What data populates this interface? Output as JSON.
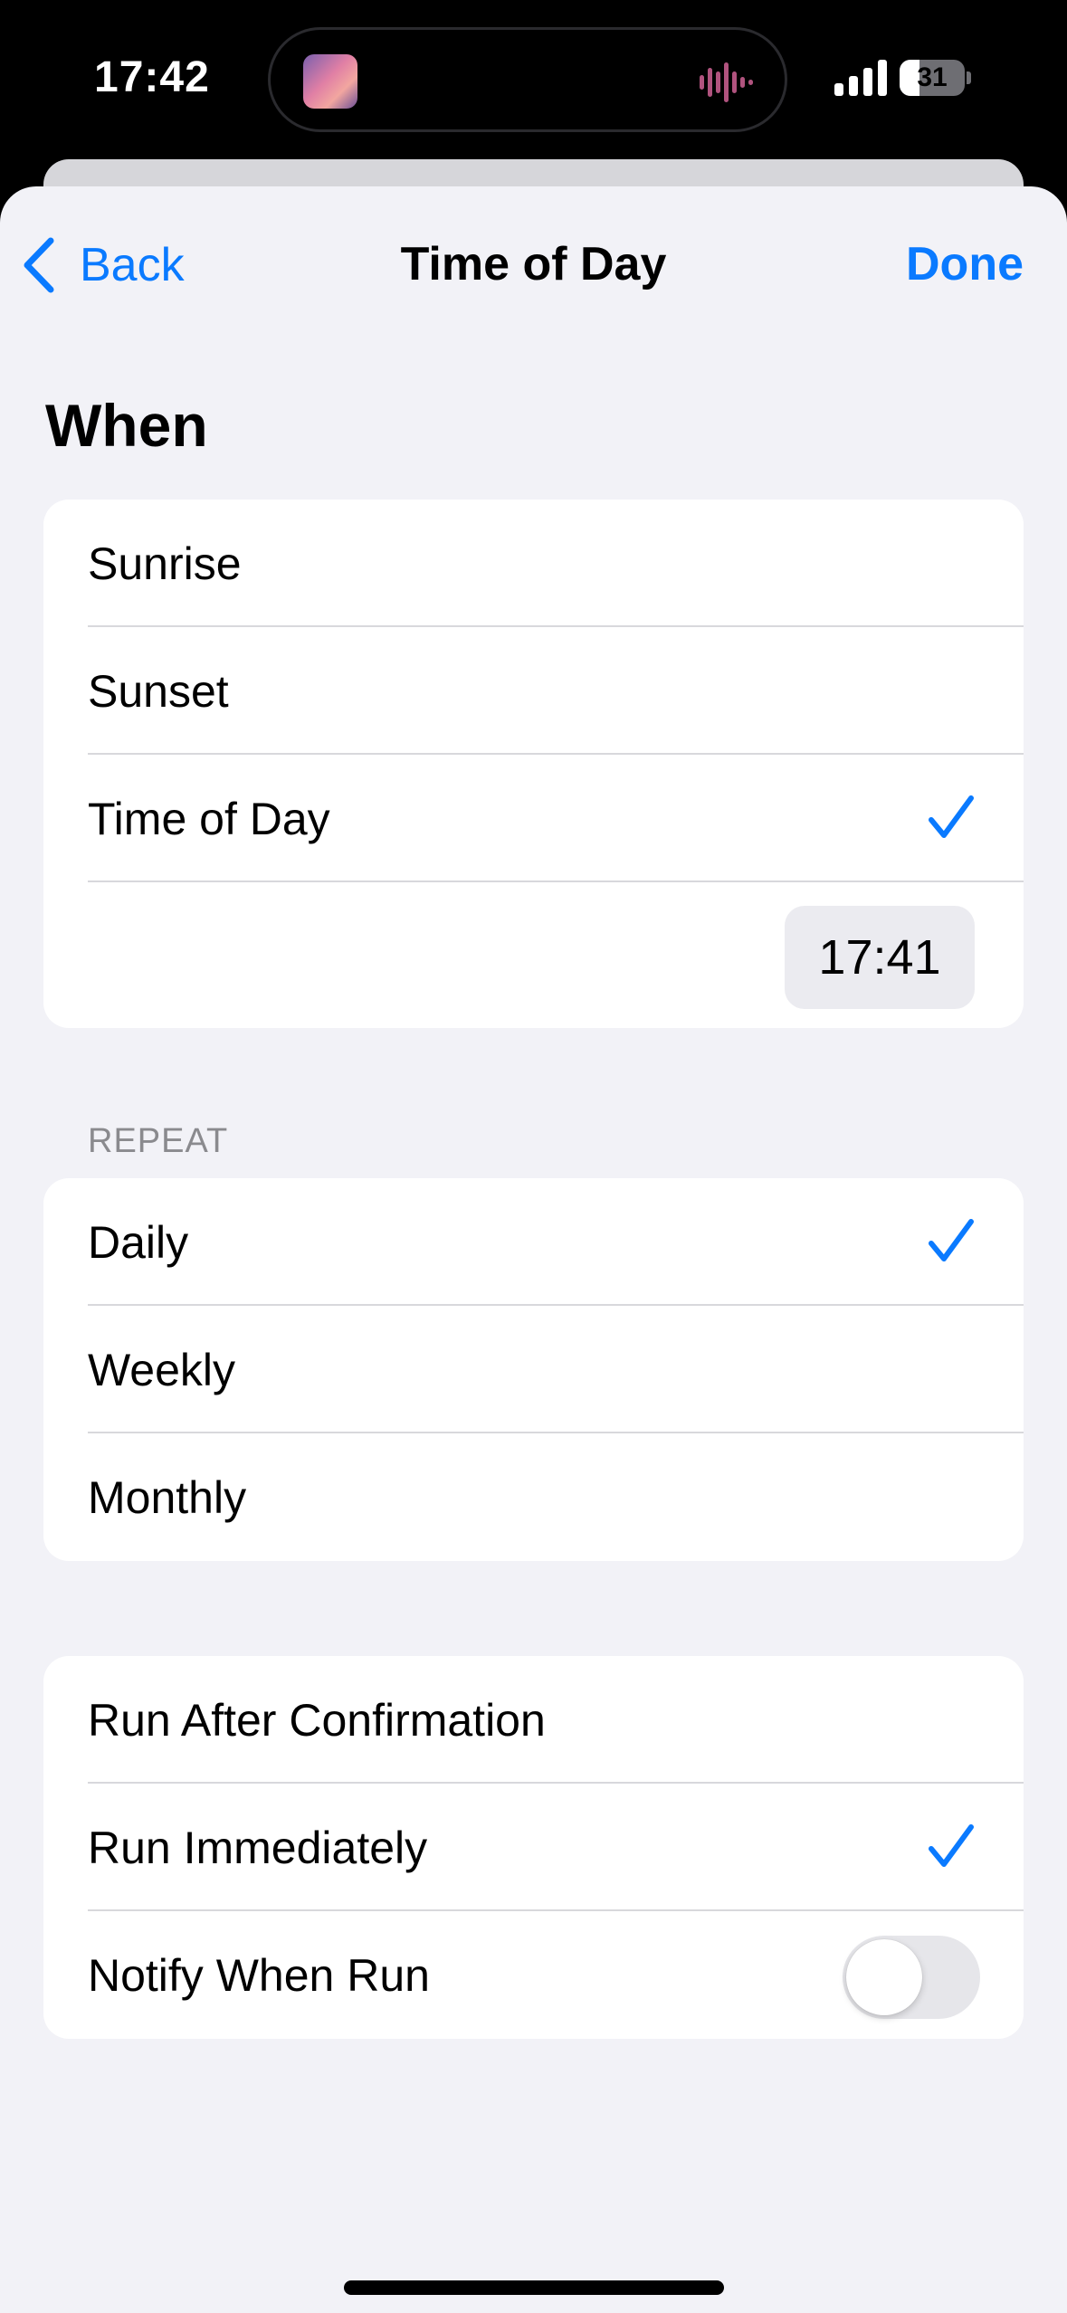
{
  "status_bar": {
    "time": "17:42",
    "battery_level": "31",
    "battery_fraction": 0.31,
    "signal_bars": 4
  },
  "nav": {
    "back_label": "Back",
    "title": "Time of Day",
    "done_label": "Done"
  },
  "when": {
    "heading": "When",
    "options": [
      {
        "label": "Sunrise",
        "selected": false
      },
      {
        "label": "Sunset",
        "selected": false
      },
      {
        "label": "Time of Day",
        "selected": true
      }
    ],
    "time_value": "17:41"
  },
  "repeat": {
    "caption": "REPEAT",
    "options": [
      {
        "label": "Daily",
        "selected": true
      },
      {
        "label": "Weekly",
        "selected": false
      },
      {
        "label": "Monthly",
        "selected": false
      }
    ]
  },
  "run": {
    "options": [
      {
        "label": "Run After Confirmation",
        "selected": false
      },
      {
        "label": "Run Immediately",
        "selected": true
      }
    ],
    "notify_label": "Notify When Run",
    "notify_enabled": false
  },
  "colors": {
    "accent": "#0a7aff",
    "background": "#f2f2f7",
    "cell": "#ffffff"
  },
  "icons": {
    "back": "chevron-left-icon",
    "check": "checkmark-icon",
    "signal": "cellular-signal-icon",
    "battery": "battery-icon"
  }
}
